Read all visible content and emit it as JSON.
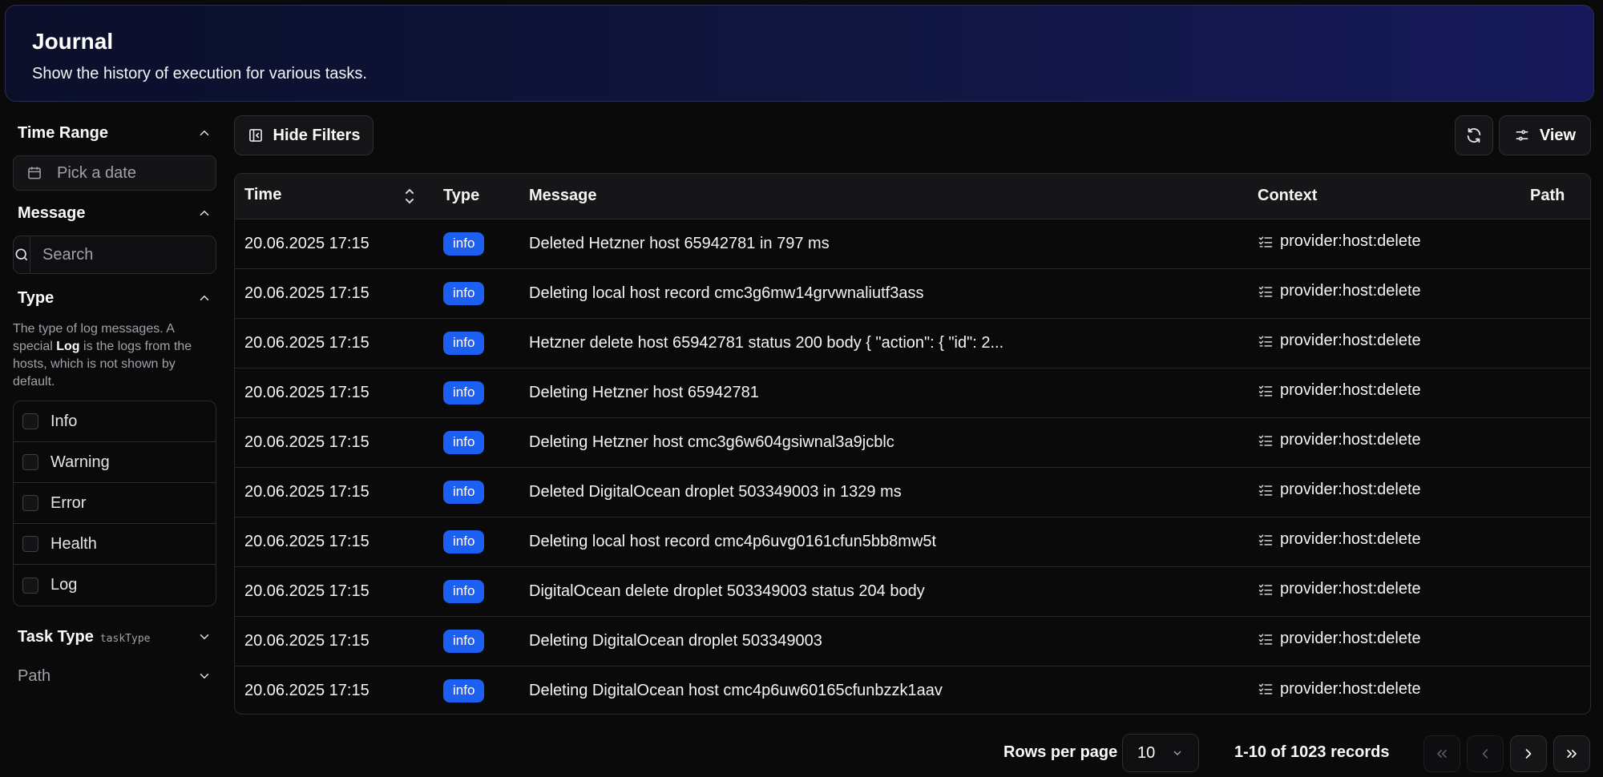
{
  "header": {
    "title": "Journal",
    "subtitle": "Show the history of execution for various tasks."
  },
  "sidebar": {
    "time_range": {
      "title": "Time Range",
      "date_placeholder": "Pick a date"
    },
    "message": {
      "title": "Message",
      "search_placeholder": "Search"
    },
    "type": {
      "title": "Type",
      "desc_before": "The type of log messages. A special ",
      "desc_bold": "Log",
      "desc_after": " is the logs from the hosts, which is not shown by default.",
      "options": [
        "Info",
        "Warning",
        "Error",
        "Health",
        "Log"
      ]
    },
    "task_type": {
      "title": "Task Type",
      "code": "taskType"
    },
    "path": {
      "title": "Path"
    }
  },
  "toolbar": {
    "hide_filters_label": "Hide Filters",
    "view_label": "View"
  },
  "table": {
    "columns": [
      "Time",
      "Type",
      "Message",
      "Context",
      "Path"
    ],
    "rows": [
      {
        "time": "20.06.2025 17:15",
        "type": "info",
        "message": "Deleted Hetzner host 65942781 in 797 ms",
        "context": "provider:host:delete",
        "path": ""
      },
      {
        "time": "20.06.2025 17:15",
        "type": "info",
        "message": "Deleting local host record cmc3g6mw14grvwnaliutf3ass",
        "context": "provider:host:delete",
        "path": ""
      },
      {
        "time": "20.06.2025 17:15",
        "type": "info",
        "message": "Hetzner delete host 65942781 status 200 body { \"action\": { \"id\": 2...",
        "context": "provider:host:delete",
        "path": ""
      },
      {
        "time": "20.06.2025 17:15",
        "type": "info",
        "message": "Deleting Hetzner host 65942781",
        "context": "provider:host:delete",
        "path": ""
      },
      {
        "time": "20.06.2025 17:15",
        "type": "info",
        "message": "Deleting Hetzner host cmc3g6w604gsiwnal3a9jcblc",
        "context": "provider:host:delete",
        "path": ""
      },
      {
        "time": "20.06.2025 17:15",
        "type": "info",
        "message": "Deleted DigitalOcean droplet 503349003 in 1329 ms",
        "context": "provider:host:delete",
        "path": ""
      },
      {
        "time": "20.06.2025 17:15",
        "type": "info",
        "message": "Deleting local host record cmc4p6uvg0161cfun5bb8mw5t",
        "context": "provider:host:delete",
        "path": ""
      },
      {
        "time": "20.06.2025 17:15",
        "type": "info",
        "message": "DigitalOcean delete droplet 503349003 status 204 body",
        "context": "provider:host:delete",
        "path": ""
      },
      {
        "time": "20.06.2025 17:15",
        "type": "info",
        "message": "Deleting DigitalOcean droplet 503349003",
        "context": "provider:host:delete",
        "path": ""
      },
      {
        "time": "20.06.2025 17:15",
        "type": "info",
        "message": "Deleting DigitalOcean host cmc4p6uw60165cfunbzzk1aav",
        "context": "provider:host:delete",
        "path": ""
      }
    ]
  },
  "pagination": {
    "rows_per_page_label": "Rows per page",
    "rows_per_page_value": "10",
    "records_text": "1-10 of 1023 records"
  },
  "colors": {
    "badge_info": "#1d5ff0",
    "background": "#0a0a0b",
    "header_gradient_end": "#16185a"
  },
  "icons": {
    "hide_filters": "panel-left-close-icon",
    "refresh": "refresh-icon",
    "view": "sliders-icon",
    "date": "calendar-icon",
    "search": "search-icon",
    "context": "list-checks-icon"
  }
}
